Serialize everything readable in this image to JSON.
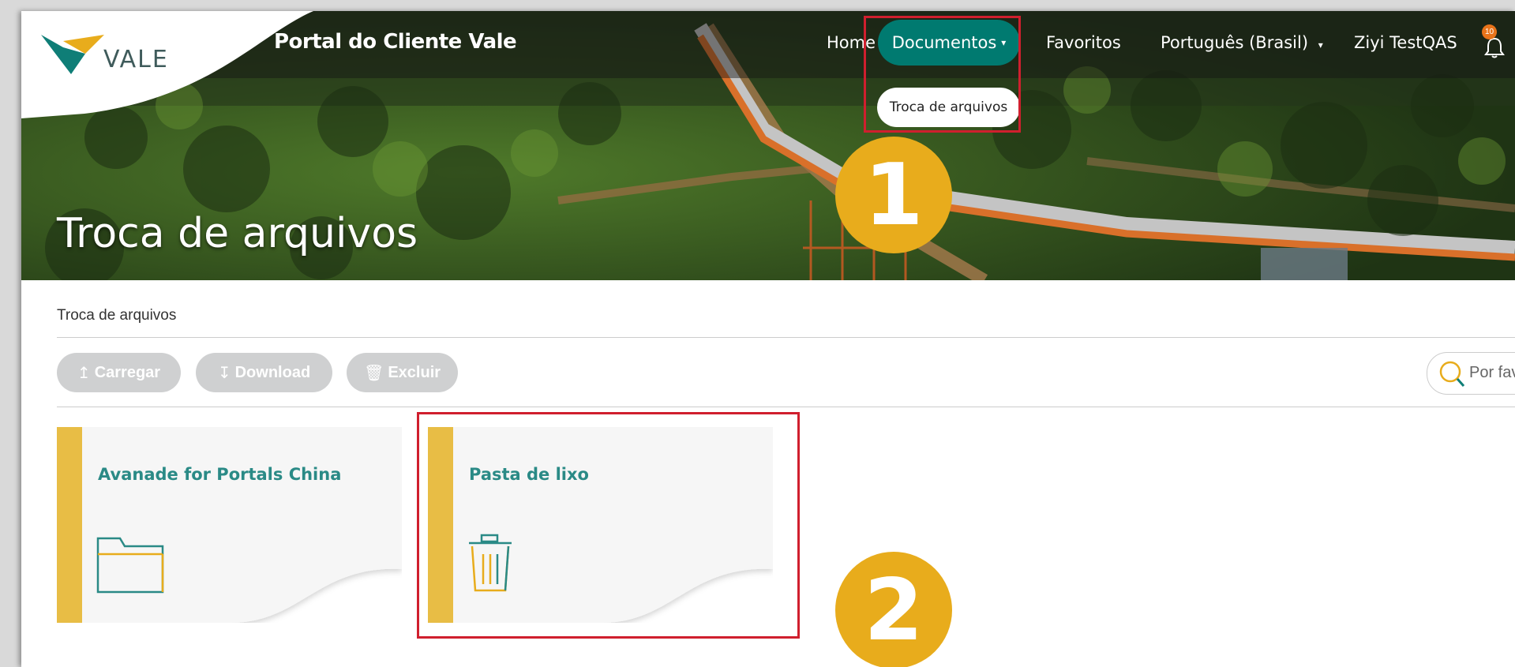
{
  "brand": {
    "logo_text": "VALE",
    "portal_title": "Portal do Cliente Vale"
  },
  "nav": {
    "home": "Home",
    "documents": "Documentos",
    "favorites": "Favoritos",
    "language": "Português (Brasil)",
    "user": "Ziyi TestQAS",
    "notification_count": "10",
    "submenu_item": "Troca de arquivos"
  },
  "hero": {
    "title": "Troca de arquivos"
  },
  "steps": [
    "1",
    "2"
  ],
  "breadcrumb": "Troca de arquivos",
  "toolbar": {
    "upload": "Carregar",
    "download": "Download",
    "delete": "Excluir",
    "search_placeholder": "Por fav"
  },
  "folders": [
    {
      "name": "Avanade for Portals China",
      "icon": "folder-icon"
    },
    {
      "name": "Pasta de lixo",
      "icon": "trash-icon"
    }
  ],
  "colors": {
    "accent_teal": "#007a70",
    "card_stripe": "#e8bd45",
    "highlight_red": "#d01f2e",
    "step_badge": "#e8ac1c"
  }
}
